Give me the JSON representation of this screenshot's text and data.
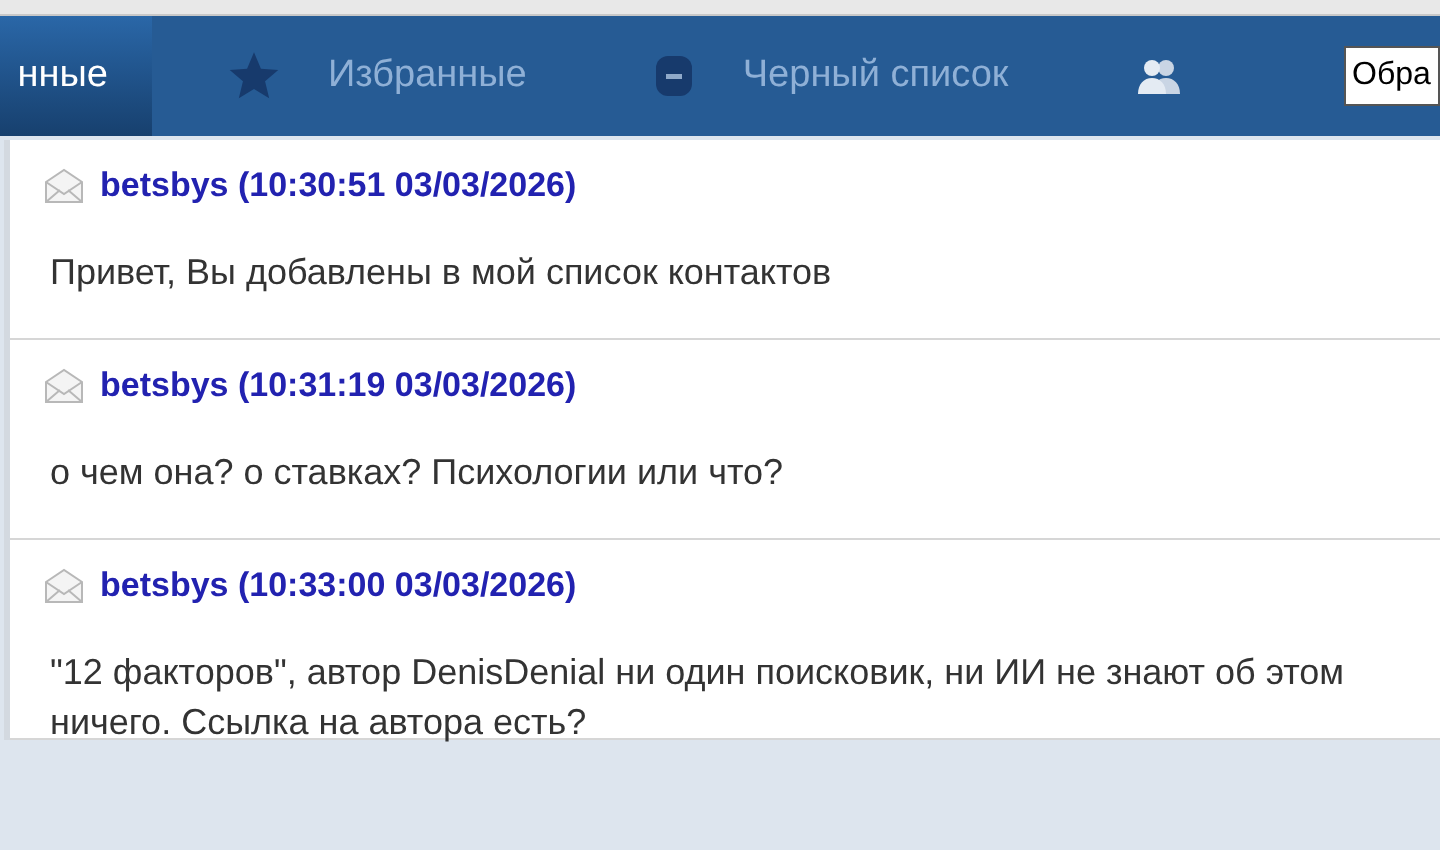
{
  "tabs": [
    {
      "label": "нные",
      "kind": "text",
      "selected": true
    },
    {
      "label": "Избранные",
      "kind": "star",
      "selected": false
    },
    {
      "label": "Черный список",
      "kind": "ban",
      "selected": false
    },
    {
      "kind": "people",
      "selected": false
    }
  ],
  "search": {
    "value": "Обра"
  },
  "messages": [
    {
      "author": "betsbys",
      "time": "(10:30:51 03/03/2026)",
      "text": "Привет, Вы добавлены в мой список контактов"
    },
    {
      "author": "betsbys",
      "time": "(10:31:19 03/03/2026)",
      "text": "о чем она? о ставках? Психологии или что?"
    },
    {
      "author": "betsbys",
      "time": "(10:33:00 03/03/2026)",
      "text": "\"12 факторов\", автор DenisDenial ни один поисковик, ни ИИ не знают об этом ничего. Ссылка на автора есть?"
    }
  ]
}
